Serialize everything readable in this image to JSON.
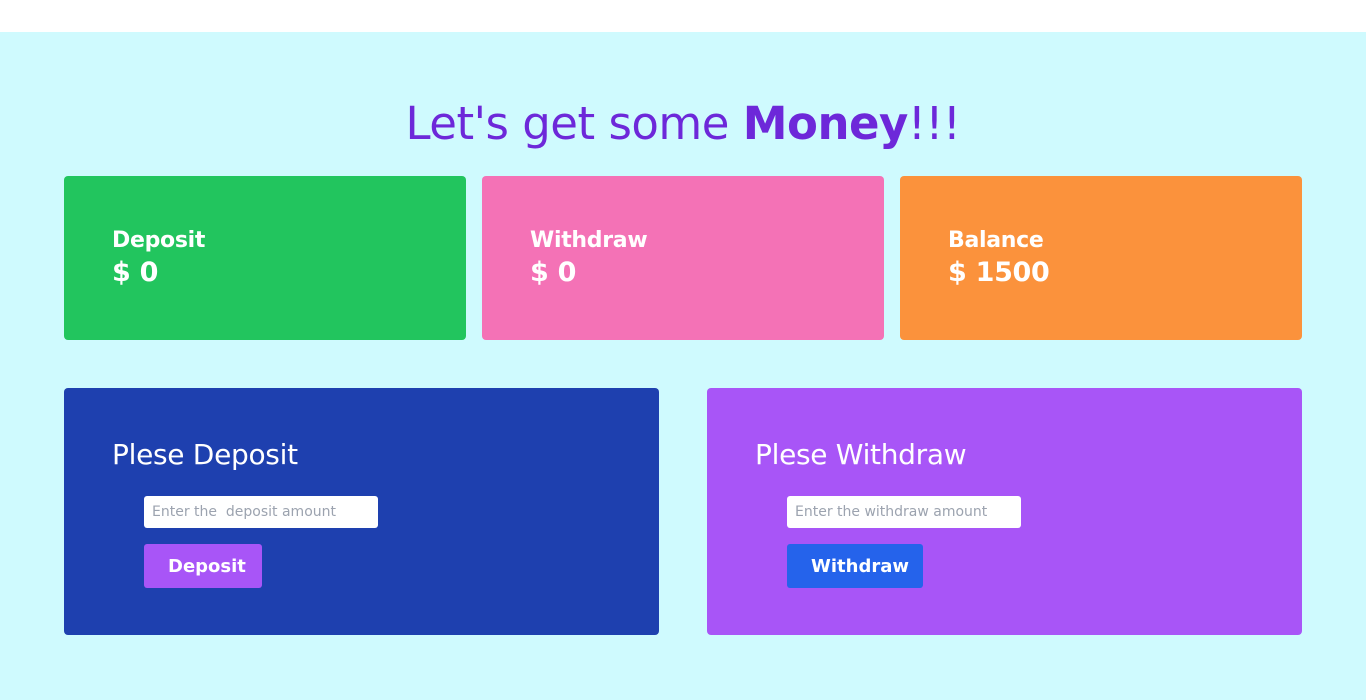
{
  "heading": {
    "prefix": "Let's get some ",
    "emphasis": "Money",
    "suffix": "!!!"
  },
  "stats": {
    "deposit": {
      "label": "Deposit",
      "value": "$ 0"
    },
    "withdraw": {
      "label": "Withdraw",
      "value": "$ 0"
    },
    "balance": {
      "label": "Balance",
      "value": "$ 1500"
    }
  },
  "deposit_panel": {
    "title": "Plese Deposit",
    "input_placeholder": "Enter the  deposit amount",
    "input_value": "",
    "button_label": "Deposit"
  },
  "withdraw_panel": {
    "title": "Plese Withdraw",
    "input_placeholder": "Enter the withdraw amount",
    "input_value": "",
    "button_label": "Withdraw"
  },
  "colors": {
    "page_background": "#cffafe",
    "heading": "#6d28d9",
    "deposit_card": "#22c55e",
    "withdraw_card": "#f472b6",
    "balance_card": "#fb923c",
    "deposit_panel": "#1e40af",
    "withdraw_panel": "#a855f7",
    "deposit_button": "#a855f7",
    "withdraw_button": "#2563eb"
  }
}
